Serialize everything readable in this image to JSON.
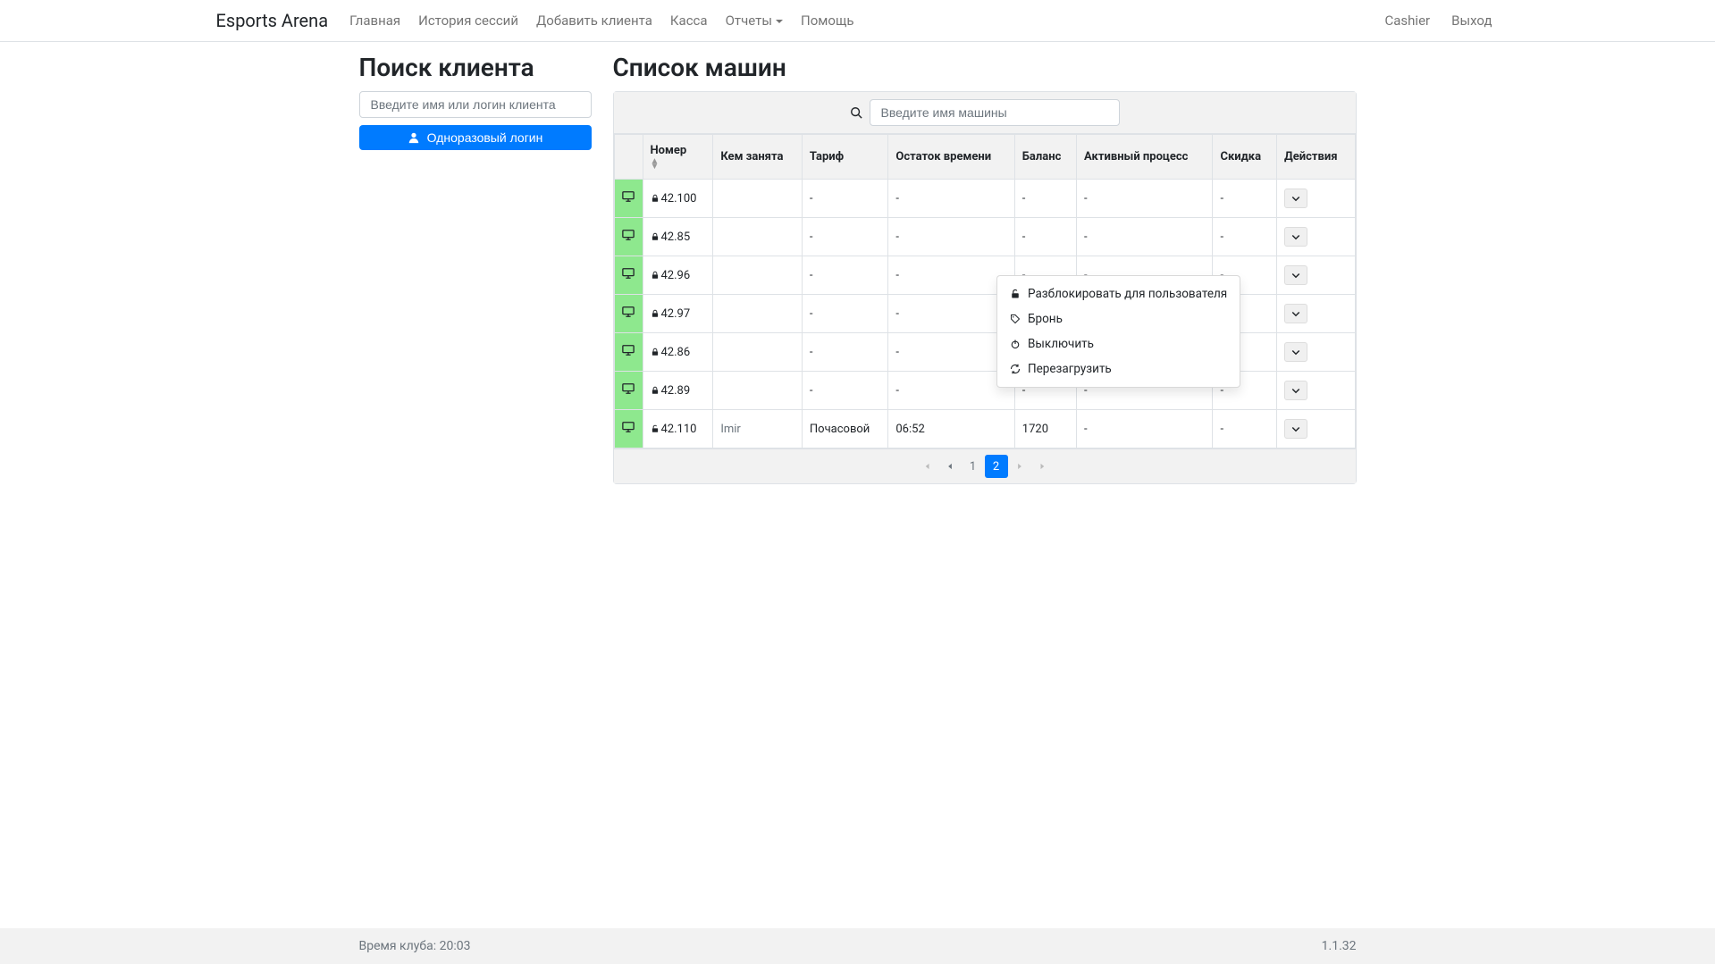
{
  "nav": {
    "brand": "Esports Arena",
    "links": {
      "home": "Главная",
      "sessions": "История сессий",
      "add_client": "Добавить клиента",
      "cashier": "Касса",
      "reports": "Отчеты",
      "help": "Помощь"
    },
    "right": {
      "user": "Cashier",
      "logout": "Выход"
    }
  },
  "search_client": {
    "title": "Поиск клиента",
    "placeholder": "Введите имя или логин клиента",
    "button": "Одноразовый логин"
  },
  "machines": {
    "title": "Список машин",
    "search_placeholder": "Введите имя машины",
    "headers": {
      "number": "Номер",
      "occupied_by": "Кем занята",
      "tariff": "Тариф",
      "time_left": "Остаток времени",
      "balance": "Баланс",
      "active_proc": "Активный процесс",
      "discount": "Скидка",
      "actions": "Действия"
    },
    "rows": [
      {
        "locked": true,
        "number": "42.100",
        "occupied_by": "",
        "tariff": "-",
        "time_left": "-",
        "balance": "-",
        "active_proc": "-",
        "discount": "-"
      },
      {
        "locked": true,
        "number": "42.85",
        "occupied_by": "",
        "tariff": "-",
        "time_left": "-",
        "balance": "-",
        "active_proc": "-",
        "discount": "-"
      },
      {
        "locked": true,
        "number": "42.96",
        "occupied_by": "",
        "tariff": "-",
        "time_left": "-",
        "balance": "-",
        "active_proc": "-",
        "discount": "-"
      },
      {
        "locked": true,
        "number": "42.97",
        "occupied_by": "",
        "tariff": "-",
        "time_left": "-",
        "balance": "-",
        "active_proc": "-",
        "discount": "-"
      },
      {
        "locked": true,
        "number": "42.86",
        "occupied_by": "",
        "tariff": "-",
        "time_left": "-",
        "balance": "-",
        "active_proc": "-",
        "discount": "-"
      },
      {
        "locked": true,
        "number": "42.89",
        "occupied_by": "",
        "tariff": "-",
        "time_left": "-",
        "balance": "-",
        "active_proc": "-",
        "discount": "-"
      },
      {
        "locked": false,
        "number": "42.110",
        "occupied_by": "Imir",
        "tariff": "Почасовой",
        "time_left": "06:52",
        "balance": "1720",
        "active_proc": "-",
        "discount": "-"
      }
    ],
    "pagination": {
      "pages": [
        "1",
        "2"
      ],
      "active": "2"
    },
    "actions_menu": {
      "unblock": "Разблокировать для пользователя",
      "reserve": "Бронь",
      "shutdown": "Выключить",
      "reboot": "Перезагрузить"
    }
  },
  "footer": {
    "club_time_label": "Время клуба:",
    "club_time_value": "20:03",
    "version": "1.1.32"
  }
}
